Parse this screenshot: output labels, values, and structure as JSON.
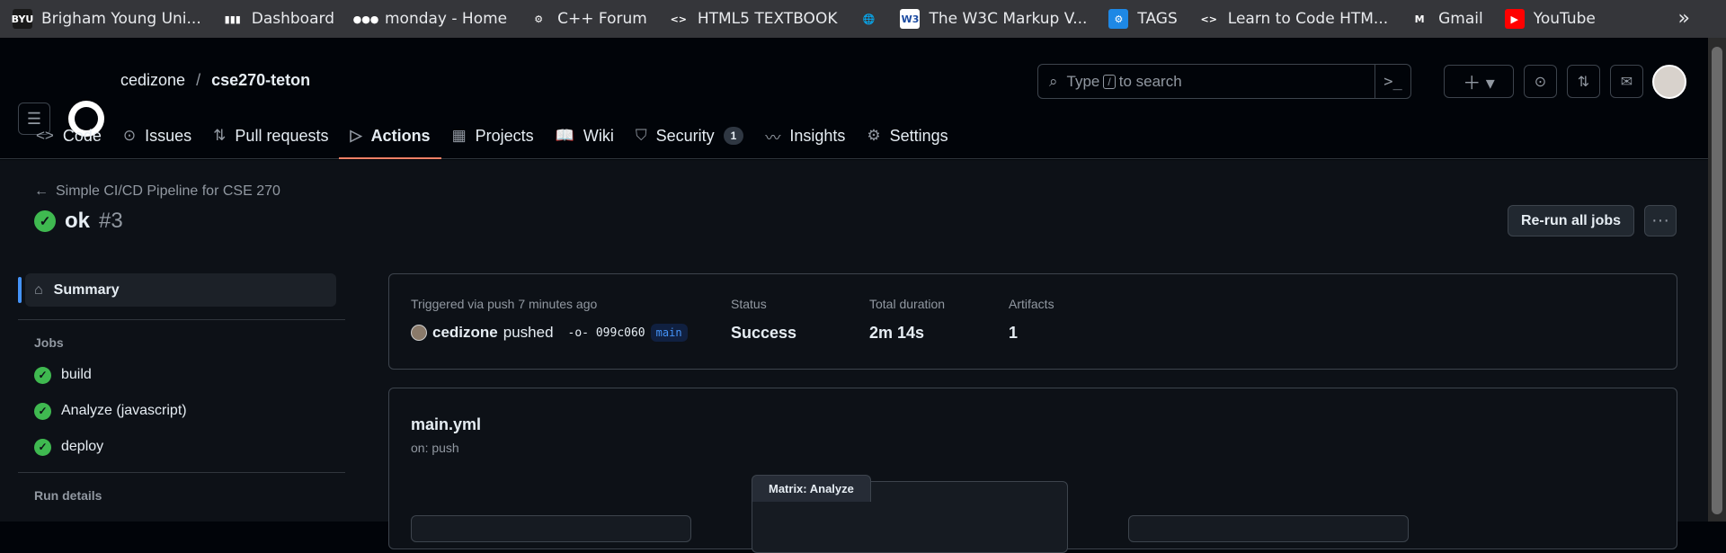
{
  "bookmarks": [
    {
      "label": "Brigham Young Uni...",
      "icon": "byu-icon",
      "color": "#1a1a1a",
      "glyph": "BYU"
    },
    {
      "label": "Dashboard",
      "icon": "chart-icon",
      "color": "#35363a",
      "glyph": "▮▮▮"
    },
    {
      "label": "monday - Home",
      "icon": "monday-icon",
      "color": "#35363a",
      "glyph": "●●●"
    },
    {
      "label": "C++ Forum",
      "icon": "cpp-icon",
      "color": "#35363a",
      "glyph": "⚙"
    },
    {
      "label": "HTML5 TEXTBOOK",
      "icon": "code-icon",
      "color": "#35363a",
      "glyph": "<>"
    },
    {
      "label": "",
      "icon": "globe-icon",
      "color": "#35363a",
      "glyph": "🌐"
    },
    {
      "label": "The W3C Markup V...",
      "icon": "w3c-icon",
      "color": "#ffffff",
      "glyph": "W3"
    },
    {
      "label": "TAGS",
      "icon": "tags-icon",
      "color": "#1e88e5",
      "glyph": "⚙"
    },
    {
      "label": "Learn to Code HTM...",
      "icon": "code-icon",
      "color": "#35363a",
      "glyph": "<>"
    },
    {
      "label": "Gmail",
      "icon": "gmail-icon",
      "color": "#35363a",
      "glyph": "M"
    },
    {
      "label": "YouTube",
      "icon": "youtube-icon",
      "color": "#ff0000",
      "glyph": "▶"
    }
  ],
  "repo": {
    "owner": "cedizone",
    "separator": "/",
    "name": "cse270-teton"
  },
  "search": {
    "prefix": "Type",
    "key": "/",
    "suffix": "to search"
  },
  "tabs": [
    {
      "label": "Code",
      "icon": "<>"
    },
    {
      "label": "Issues",
      "icon": "⊙"
    },
    {
      "label": "Pull requests",
      "icon": "⇅"
    },
    {
      "label": "Actions",
      "icon": "▷"
    },
    {
      "label": "Projects",
      "icon": "▦"
    },
    {
      "label": "Wiki",
      "icon": "📖"
    },
    {
      "label": "Security",
      "icon": "⛉",
      "count": "1"
    },
    {
      "label": "Insights",
      "icon": "〰"
    },
    {
      "label": "Settings",
      "icon": "⚙"
    }
  ],
  "run": {
    "workflow": "Simple CI/CD Pipeline for CSE 270",
    "name": "ok",
    "number": "#3",
    "rerun_label": "Re-run all jobs"
  },
  "sidebar": {
    "summary": "Summary",
    "jobs_heading": "Jobs",
    "jobs": [
      "build",
      "Analyze (javascript)",
      "deploy"
    ],
    "run_details": "Run details"
  },
  "info": {
    "trigger_label": "Triggered via push 7 minutes ago",
    "actor": "cedizone",
    "action": "pushed",
    "sha": "099c060",
    "branch": "main",
    "status_label": "Status",
    "status_value": "Success",
    "duration_label": "Total duration",
    "duration_value": "2m 14s",
    "artifacts_label": "Artifacts",
    "artifacts_value": "1"
  },
  "workflow": {
    "file": "main.yml",
    "trigger": "on: push",
    "matrix_label": "Matrix: Analyze"
  }
}
